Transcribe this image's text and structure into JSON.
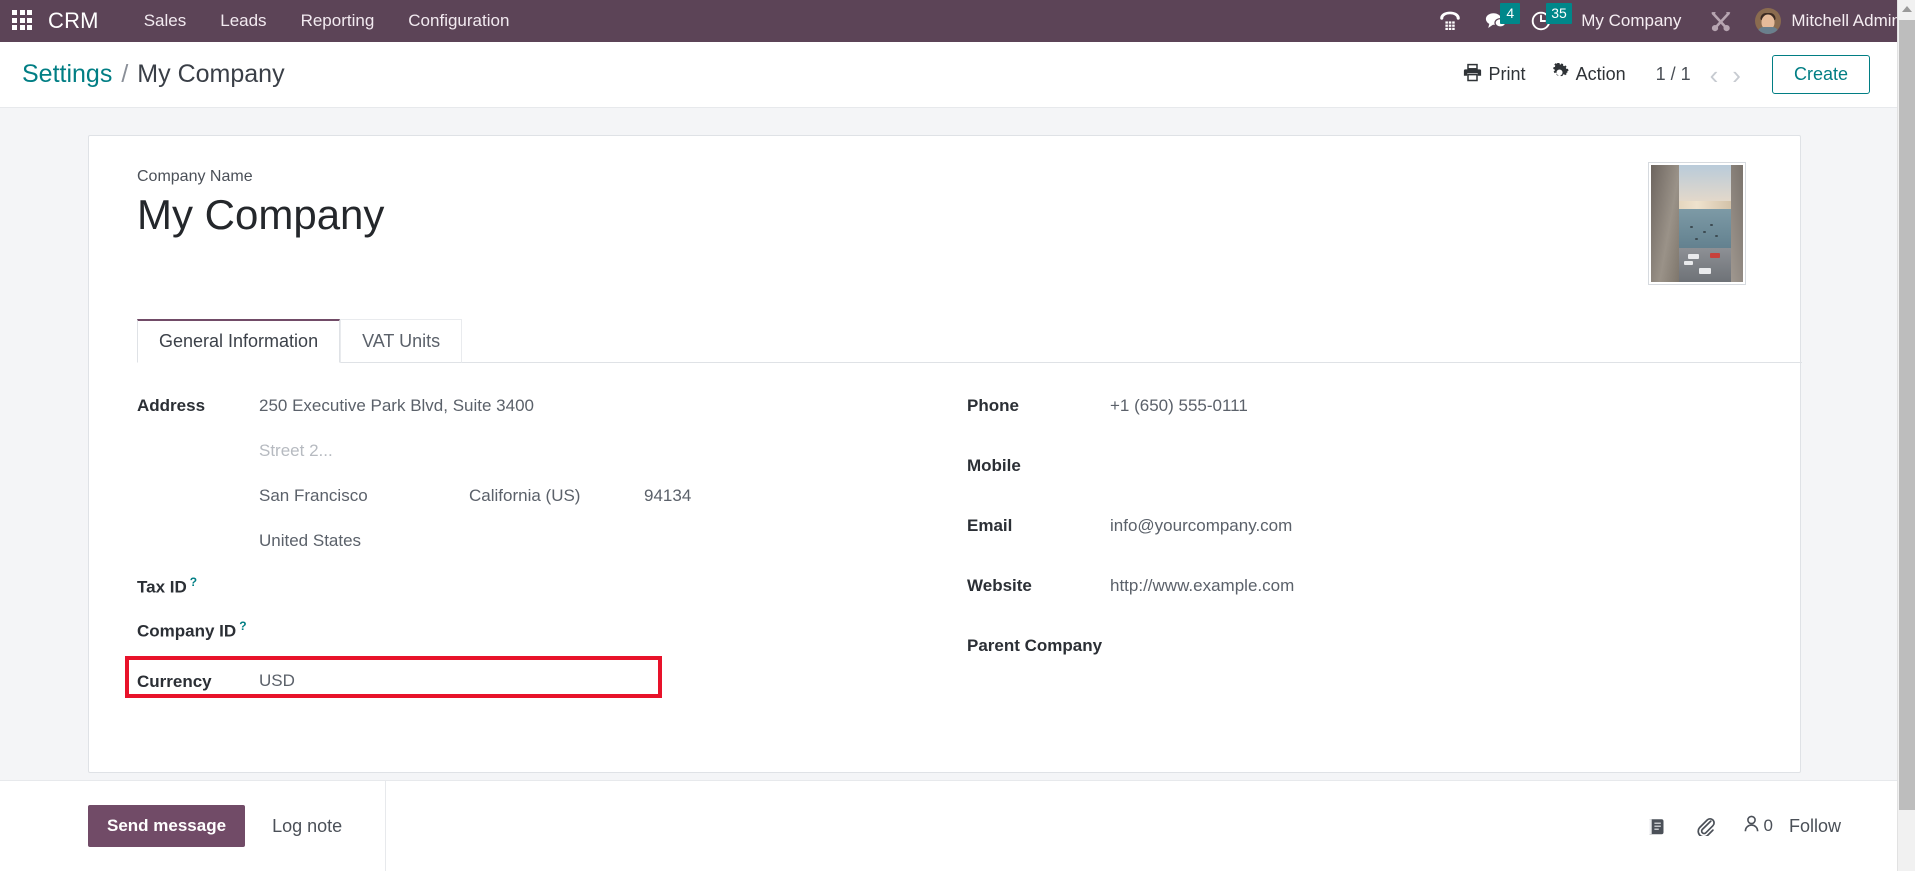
{
  "theme": {
    "navbar_bg": "#5c4457",
    "accent_purple": "#714b67",
    "accent_teal": "#017e84",
    "badge_teal": "#00878a",
    "highlight_red": "#e8122a",
    "page_bg": "#f4f5f7"
  },
  "navbar": {
    "apps_icon": "apps-grid-icon",
    "brand": "CRM",
    "menu_items": [
      {
        "label": "Sales"
      },
      {
        "label": "Leads"
      },
      {
        "label": "Reporting"
      },
      {
        "label": "Configuration"
      }
    ],
    "icons": [
      {
        "name": "phone-dialpad-icon",
        "badge": null
      },
      {
        "name": "chat-bubble-icon",
        "badge": "4"
      },
      {
        "name": "activity-clock-icon",
        "badge": "35"
      }
    ],
    "company_switcher": "My Company",
    "tools_icon": "wrench-screwdriver-icon",
    "user_avatar": "avatar",
    "user_name": "Mitchell Admin"
  },
  "control_panel": {
    "breadcrumb": {
      "root": "Settings",
      "separator": "/",
      "current": "My Company"
    },
    "print_label": "Print",
    "print_icon": "printer-icon",
    "action_label": "Action",
    "action_icon": "gear-icon",
    "pager": "1 / 1",
    "prev_icon": "chevron-left-icon",
    "next_icon": "chevron-right-icon",
    "create_label": "Create"
  },
  "form": {
    "company_name_label": "Company Name",
    "company_name_value": "My Company",
    "logo_alt": "company-logo-photo",
    "tabs": [
      {
        "label": "General Information",
        "active": true
      },
      {
        "label": "VAT Units",
        "active": false
      }
    ],
    "left_column": {
      "address_label": "Address",
      "address": {
        "street": "250 Executive Park Blvd, Suite 3400",
        "street2_placeholder": "Street 2...",
        "city": "San Francisco",
        "state": "California (US)",
        "zip": "94134",
        "country": "United States"
      },
      "tax_id_label": "Tax ID",
      "tax_id_value": "",
      "company_id_label": "Company ID",
      "company_id_value": "",
      "currency_label": "Currency",
      "currency_value": "USD",
      "help_marker": "?"
    },
    "right_column": {
      "phone_label": "Phone",
      "phone_value": "+1 (650) 555-0111",
      "mobile_label": "Mobile",
      "mobile_value": "",
      "email_label": "Email",
      "email_value": "info@yourcompany.com",
      "website_label": "Website",
      "website_value": "http://www.example.com",
      "parent_company_label": "Parent Company",
      "parent_company_value": ""
    }
  },
  "chatter": {
    "send_message_label": "Send message",
    "log_note_label": "Log note",
    "log_icon": "activity-log-icon",
    "attachment_icon": "paperclip-icon",
    "follower_icon": "user-icon",
    "follower_count": "0",
    "follow_label": "Follow"
  },
  "scrollbar": {
    "up_arrow_icon": "caret-up-icon"
  }
}
